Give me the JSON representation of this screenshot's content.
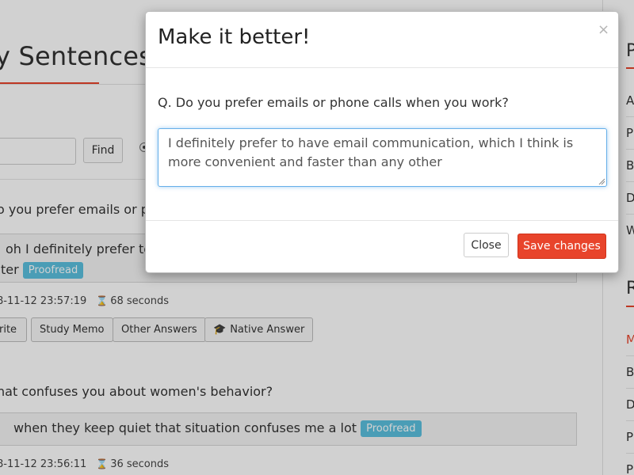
{
  "page": {
    "title": "y Sentences",
    "find_label": "Find",
    "sidebar": {
      "heading1": "P",
      "items1": [
        "A",
        "P",
        "B",
        "D",
        "W"
      ],
      "heading2": "R",
      "items2": [
        "M",
        "B",
        "D",
        "P",
        "P"
      ]
    },
    "entries": [
      {
        "question": "o you prefer emails or pho",
        "answer_line1": "oh I definitely prefer to h",
        "answer_line2": "ter",
        "badge": "Proofread",
        "date": "8-11-12 23:57:19",
        "duration": "68 seconds"
      },
      {
        "question": "hat confuses you about women's behavior?",
        "answer_line1": "when they keep quiet that situation confuses me a lot",
        "badge": "Proofread",
        "date": "8-11-12 23:56:11",
        "duration": "36 seconds"
      }
    ],
    "chips": [
      "rite",
      "Study Memo",
      "Other Answers",
      "Native Answer"
    ]
  },
  "modal": {
    "title": "Make it better!",
    "close_x": "×",
    "question": "Q. Do you prefer emails or phone calls when you work?",
    "answer": "I definitely prefer to have email communication, which I think is more convenient and faster than any other",
    "close_button": "Close",
    "save_button": "Save changes"
  },
  "colors": {
    "accent": "#e8442b",
    "badge": "#5bc0de",
    "focus": "#66afe9"
  }
}
